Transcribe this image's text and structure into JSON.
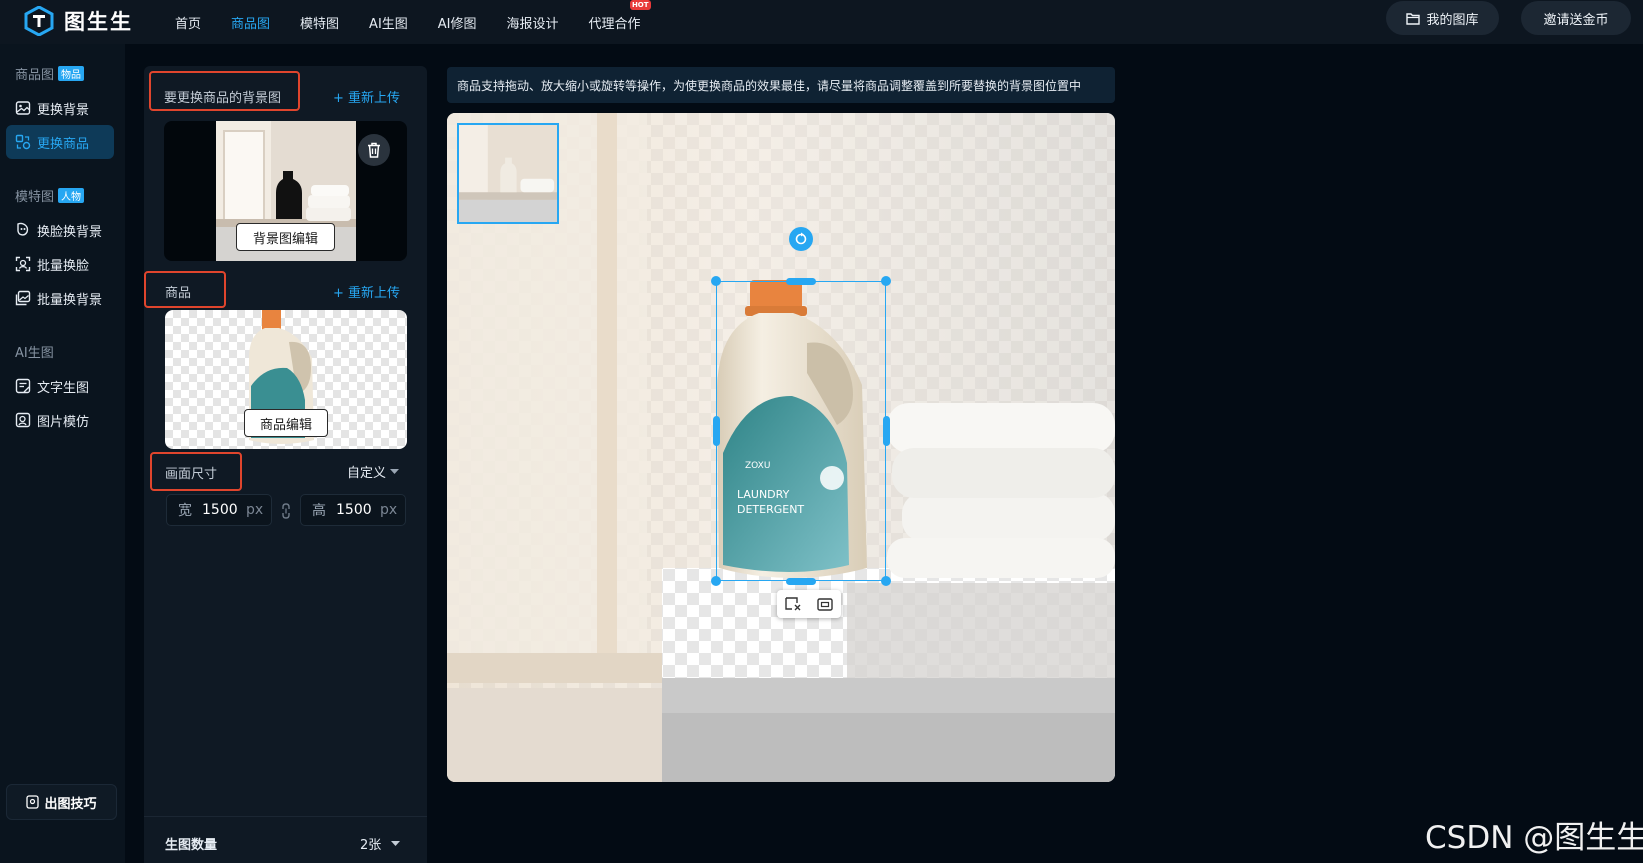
{
  "app": {
    "name": "图生生"
  },
  "nav": {
    "items": [
      "首页",
      "商品图",
      "模特图",
      "AI生图",
      "AI修图",
      "海报设计",
      "代理合作"
    ],
    "active": "商品图",
    "hot_badge": "HOT"
  },
  "header": {
    "library_label": "我的图库",
    "invite_label": "邀请送金币"
  },
  "sidebar": {
    "sections": [
      {
        "title": "商品图",
        "tag": "物品"
      },
      {
        "title": "模特图",
        "tag": "人物"
      },
      {
        "title": "AI生图",
        "tag": ""
      }
    ],
    "items": [
      "更换背景",
      "更换商品",
      "换脸换背景",
      "批量换脸",
      "批量换背景",
      "文字生图",
      "图片模仿"
    ],
    "active_item": "更换商品",
    "tips_label": "出图技巧"
  },
  "panel": {
    "background_label": "要更换商品的背景图",
    "reupload_label": "+ 重新上传",
    "background_edit_label": "背景图编辑",
    "product_label": "商品",
    "product_edit_label": "商品编辑",
    "size_label": "画面尺寸",
    "size_mode": "自定义",
    "width_label": "宽",
    "width_value": "1500",
    "height_label": "高",
    "height_value": "1500",
    "unit": "px",
    "count_label": "生图数量",
    "count_value": "2张"
  },
  "hint": "商品支持拖动、放大缩小或旋转等操作，为使更换商品的效果最佳，请尽量将商品调整覆盖到所要替换的背景图位置中",
  "product_text": {
    "brand": "ZOXU",
    "line1": "LAUNDRY",
    "line2": "DETERGENT"
  },
  "watermark": "CSDN @图生生",
  "colors": {
    "accent": "#27a7f2",
    "highlight_box": "#e0452d",
    "background": "#030b14"
  }
}
